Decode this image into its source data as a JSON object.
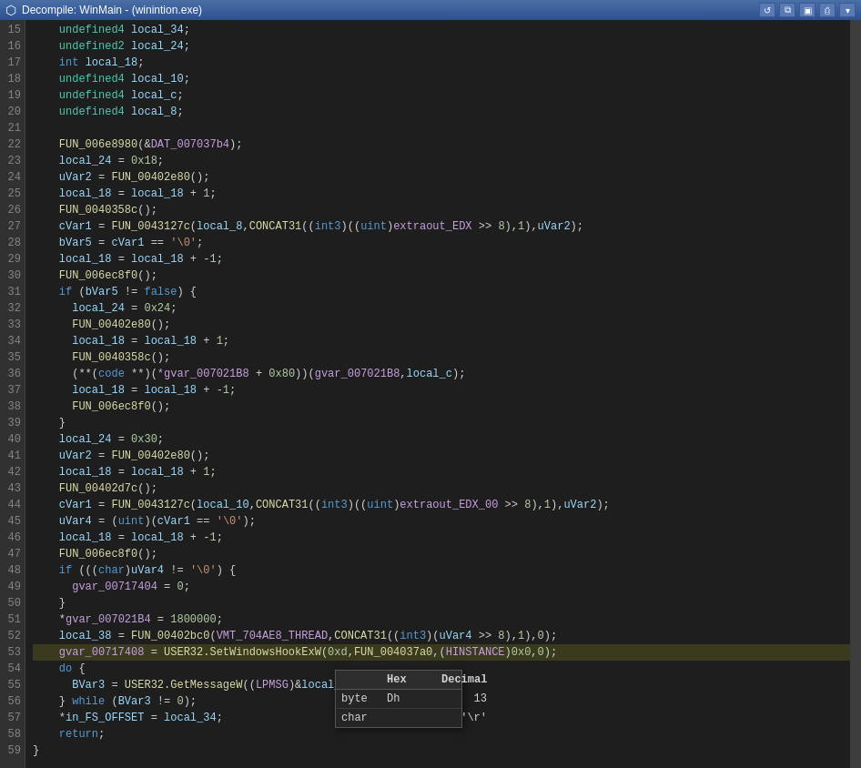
{
  "titlebar": {
    "title": "Decompile: WinMain - (winintion.exe)",
    "icon": "⬡"
  },
  "toolbar": {
    "buttons": [
      "↺",
      "📋",
      "⊞",
      "🖨",
      "▾"
    ]
  },
  "lines": [
    {
      "num": 15,
      "code": "    <span class='type'>undefined4</span> <span class='var'>local_34</span><span class='punc'>;</span>"
    },
    {
      "num": 16,
      "code": "    <span class='type'>undefined2</span> <span class='var'>local_24</span><span class='punc'>;</span>"
    },
    {
      "num": 17,
      "code": "    <span class='kw'>int</span> <span class='var'>local_18</span><span class='punc'>;</span>"
    },
    {
      "num": 18,
      "code": "    <span class='type'>undefined4</span> <span class='var'>local_10</span><span class='punc'>;</span>"
    },
    {
      "num": 19,
      "code": "    <span class='type'>undefined4</span> <span class='var'>local_c</span><span class='punc'>;</span>"
    },
    {
      "num": 20,
      "code": "    <span class='type'>undefined4</span> <span class='var'>local_8</span><span class='punc'>;</span>"
    },
    {
      "num": 21,
      "code": ""
    },
    {
      "num": 22,
      "code": "    <span class='fn'>FUN_006e8980</span><span class='punc'>(&amp;</span><span class='macro'>DAT_007037b4</span><span class='punc'>);</span>"
    },
    {
      "num": 23,
      "code": "    <span class='var'>local_24</span> <span class='op'>=</span> <span class='num'>0x18</span><span class='punc'>;</span>"
    },
    {
      "num": 24,
      "code": "    <span class='var'>uVar2</span> <span class='op'>=</span> <span class='fn'>FUN_00402e80</span><span class='punc'>();</span>"
    },
    {
      "num": 25,
      "code": "    <span class='var'>local_18</span> <span class='op'>=</span> <span class='var'>local_18</span> <span class='op'>+</span> <span class='num'>1</span><span class='punc'>;</span>"
    },
    {
      "num": 26,
      "code": "    <span class='fn'>FUN_0040358c</span><span class='punc'>();</span>"
    },
    {
      "num": 27,
      "code": "    <span class='var'>cVar1</span> <span class='op'>=</span> <span class='fn'>FUN_0043127c</span><span class='punc'>(</span><span class='var'>local_8</span><span class='punc'>,</span><span class='fn'>CONCAT31</span><span class='punc'>((<span class='kw'>int3</span>)((<span class='kw'>uint</span>)</span><span class='macro'>extraout_EDX</span> <span class='op'>&gt;&gt;</span> <span class='num'>8</span><span class='punc'>),</span><span class='num'>1</span><span class='punc'>),</span><span class='var'>uVar2</span><span class='punc'>);</span>"
    },
    {
      "num": 28,
      "code": "    <span class='var'>bVar5</span> <span class='op'>=</span> <span class='var'>cVar1</span> <span class='op'>==</span> <span class='str'>'\\0'</span><span class='punc'>;</span>"
    },
    {
      "num": 29,
      "code": "    <span class='var'>local_18</span> <span class='op'>=</span> <span class='var'>local_18</span> <span class='op'>+</span> <span class='op'>-</span><span class='num'>1</span><span class='punc'>;</span>"
    },
    {
      "num": 30,
      "code": "    <span class='fn'>FUN_006ec8f0</span><span class='punc'>();</span>"
    },
    {
      "num": 31,
      "code": "    <span class='kw'>if</span> <span class='punc'>(</span><span class='var'>bVar5</span> <span class='op'>!=</span> <span class='kw'>false</span><span class='punc'>) {</span>"
    },
    {
      "num": 32,
      "code": "      <span class='var'>local_24</span> <span class='op'>=</span> <span class='num'>0x24</span><span class='punc'>;</span>"
    },
    {
      "num": 33,
      "code": "      <span class='fn'>FUN_00402e80</span><span class='punc'>();</span>"
    },
    {
      "num": 34,
      "code": "      <span class='var'>local_18</span> <span class='op'>=</span> <span class='var'>local_18</span> <span class='op'>+</span> <span class='num'>1</span><span class='punc'>;</span>"
    },
    {
      "num": 35,
      "code": "      <span class='fn'>FUN_0040358c</span><span class='punc'>();</span>"
    },
    {
      "num": 36,
      "code": "      <span class='punc'>(**(<span class='kw'>code</span> **)(</span><span class='macro'>*gvar_007021B8</span> <span class='op'>+</span> <span class='num'>0x80</span><span class='punc'>))(</span><span class='macro'>gvar_007021B8</span><span class='punc'>,</span><span class='var'>local_c</span><span class='punc'>);</span>"
    },
    {
      "num": 37,
      "code": "      <span class='var'>local_18</span> <span class='op'>=</span> <span class='var'>local_18</span> <span class='op'>+</span> <span class='op'>-</span><span class='num'>1</span><span class='punc'>;</span>"
    },
    {
      "num": 38,
      "code": "      <span class='fn'>FUN_006ec8f0</span><span class='punc'>();</span>"
    },
    {
      "num": 39,
      "code": "    <span class='punc'>}</span>"
    },
    {
      "num": 40,
      "code": "    <span class='var'>local_24</span> <span class='op'>=</span> <span class='num'>0x30</span><span class='punc'>;</span>"
    },
    {
      "num": 41,
      "code": "    <span class='var'>uVar2</span> <span class='op'>=</span> <span class='fn'>FUN_00402e80</span><span class='punc'>();</span>"
    },
    {
      "num": 42,
      "code": "    <span class='var'>local_18</span> <span class='op'>=</span> <span class='var'>local_18</span> <span class='op'>+</span> <span class='num'>1</span><span class='punc'>;</span>"
    },
    {
      "num": 43,
      "code": "    <span class='fn'>FUN_00402d7c</span><span class='punc'>();</span>"
    },
    {
      "num": 44,
      "code": "    <span class='var'>cVar1</span> <span class='op'>=</span> <span class='fn'>FUN_0043127c</span><span class='punc'>(</span><span class='var'>local_10</span><span class='punc'>,</span><span class='fn'>CONCAT31</span><span class='punc'>((<span class='kw'>int3</span>)((<span class='kw'>uint</span>)</span><span class='macro'>extraout_EDX_00</span> <span class='op'>&gt;&gt;</span> <span class='num'>8</span><span class='punc'>),</span><span class='num'>1</span><span class='punc'>),</span><span class='var'>uVar2</span><span class='punc'>);</span>"
    },
    {
      "num": 45,
      "code": "    <span class='var'>uVar4</span> <span class='op'>=</span> <span class='punc'>(</span><span class='kw'>uint</span><span class='punc'>)(</span><span class='var'>cVar1</span> <span class='op'>==</span> <span class='str'>'\\0'</span><span class='punc'>);</span>"
    },
    {
      "num": 46,
      "code": "    <span class='var'>local_18</span> <span class='op'>=</span> <span class='var'>local_18</span> <span class='op'>+</span> <span class='op'>-</span><span class='num'>1</span><span class='punc'>;</span>"
    },
    {
      "num": 47,
      "code": "    <span class='fn'>FUN_006ec8f0</span><span class='punc'>();</span>"
    },
    {
      "num": 48,
      "code": "    <span class='kw'>if</span> <span class='punc'>(((<span class='kw'>char</span>)</span><span class='var'>uVar4</span> <span class='op'>!=</span> <span class='str'>'\\0'</span><span class='punc'>) {</span>"
    },
    {
      "num": 49,
      "code": "      <span class='macro'>gvar_00717404</span> <span class='op'>=</span> <span class='num'>0</span><span class='punc'>;</span>"
    },
    {
      "num": 50,
      "code": "    <span class='punc'>}</span>"
    },
    {
      "num": 51,
      "code": "    <span class='op'>*</span><span class='macro'>gvar_007021B4</span> <span class='op'>=</span> <span class='num'>1800000</span><span class='punc'>;</span>"
    },
    {
      "num": 52,
      "code": "    <span class='var'>local_38</span> <span class='op'>=</span> <span class='fn'>FUN_00402bc0</span><span class='punc'>(</span><span class='macro'>VMT_704AE8_THREAD</span><span class='punc'>,</span><span class='fn'>CONCAT31</span><span class='punc'>((<span class='kw'>int3</span>)(</span><span class='var'>uVar4</span> <span class='op'>&gt;&gt;</span> <span class='num'>8</span><span class='punc'>),</span><span class='num'>1</span><span class='punc'>),</span><span class='num'>0</span><span class='punc'>);</span>"
    },
    {
      "num": 53,
      "code": "    <span class='macro'>gvar_00717408</span> <span class='op'>=</span> <span class='fn'>USER32.SetWindowsHookExW</span><span class='punc'>(</span><span class='num'>0xd</span><span class='punc'>,</span><span class='fn'>FUN_004037a0</span><span class='punc'>,(</span><span class='macro'>HINSTANCE</span><span class='punc'>)</span><span class='num'>0x0</span><span class='punc'>,</span><span class='num'>0</span><span class='punc'>);</span>",
      "highlighted": true
    },
    {
      "num": 54,
      "code": "    <span class='kw'>do</span> <span class='punc'>{</span>"
    },
    {
      "num": 55,
      "code": "      <span class='var'>BVar3</span> <span class='op'>=</span> <span class='fn'>USER32.GetMessageW</span><span class='punc'>((</span><span class='macro'>LPMSG</span><span class='punc'>)&amp;</span><span class='var'>local_54</span>"
    },
    {
      "num": 56,
      "code": "    <span class='punc'>}</span> <span class='kw'>while</span> <span class='punc'>(</span><span class='var'>BVar3</span> <span class='op'>!=</span> <span class='num'>0</span><span class='punc'>);</span>"
    },
    {
      "num": 57,
      "code": "    <span class='op'>*</span><span class='var'>in_FS_OFFSET</span> <span class='op'>=</span> <span class='var'>local_34</span><span class='punc'>;</span>"
    },
    {
      "num": 58,
      "code": "    <span class='kw'>return</span><span class='punc'>;</span>"
    },
    {
      "num": 59,
      "code": "<span class='punc'>}</span>"
    }
  ],
  "tooltip": {
    "header": [
      "Hex",
      "Decimal",
      ""
    ],
    "row_byte": {
      "label": "byte",
      "hex": "Dh",
      "decimal": "13"
    },
    "row_char": {
      "label": "char",
      "hex": "",
      "value": "'\\r'"
    }
  },
  "colors": {
    "highlight_bg": "#3a3a1e",
    "tooltip_bg": "#252526",
    "gutter_bg": "#313131",
    "code_bg": "#1e1e1e"
  }
}
